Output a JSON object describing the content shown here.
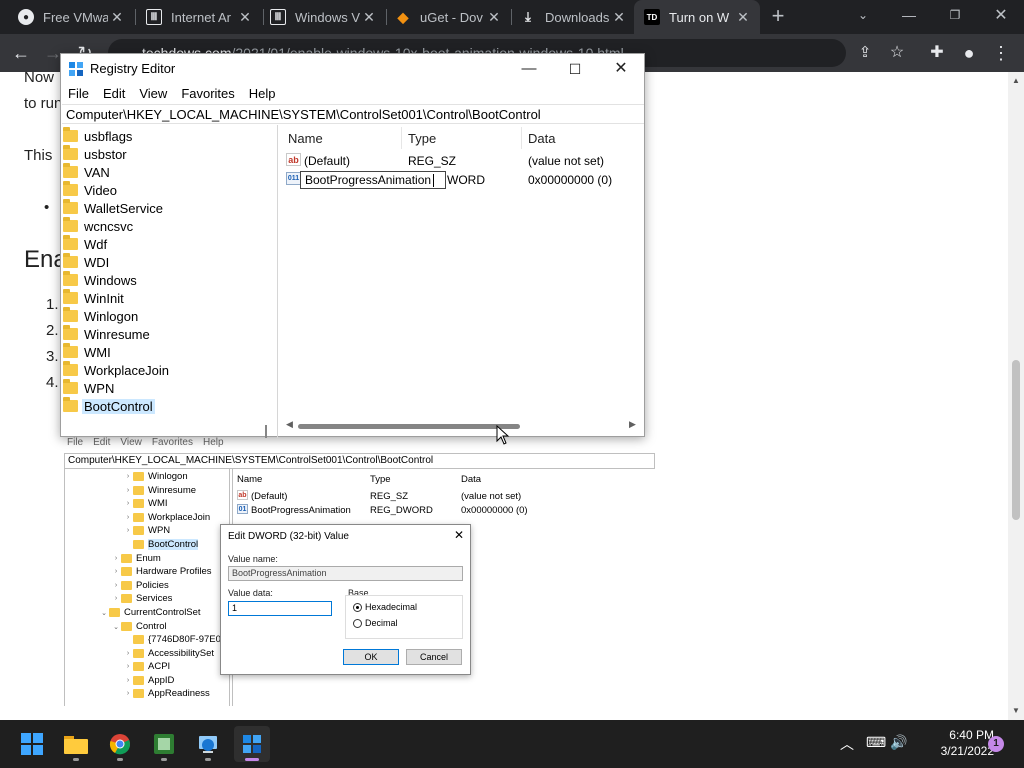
{
  "browser": {
    "tabs": [
      {
        "title": "Free VMwa",
        "icon": "github-icon"
      },
      {
        "title": "Internet Ar",
        "icon": "archive-icon"
      },
      {
        "title": "Windows V",
        "icon": "archive-icon"
      },
      {
        "title": "uGet - Dov",
        "icon": "uget-icon"
      },
      {
        "title": "Downloads",
        "icon": "download-icon"
      },
      {
        "title": "Turn on W",
        "icon": "td-icon",
        "active": true
      }
    ],
    "tab_close": "✕",
    "new_tab": "+",
    "url_host": "techdows.com",
    "url_path": "/2021/01/enable-windows-10x-boot-animation-windows-10.html"
  },
  "page": {
    "line1": "Now",
    "line2": "to run",
    "line3": "This",
    "bullet": "•",
    "heading": "Ena",
    "list": [
      "1.",
      "2.",
      "3.",
      "4."
    ]
  },
  "regedit": {
    "title": "Registry Editor",
    "menu": [
      "File",
      "Edit",
      "View",
      "Favorites",
      "Help"
    ],
    "address": "Computer\\HKEY_LOCAL_MACHINE\\SYSTEM\\ControlSet001\\Control\\BootControl",
    "tree": [
      "usbflags",
      "usbstor",
      "VAN",
      "Video",
      "WalletService",
      "wcncsvc",
      "Wdf",
      "WDI",
      "Windows",
      "WinInit",
      "Winlogon",
      "Winresume",
      "WMI",
      "WorkplaceJoin",
      "WPN",
      "BootControl"
    ],
    "selected": "BootControl",
    "columns": {
      "name": "Name",
      "type": "Type",
      "data": "Data"
    },
    "rows": [
      {
        "name": "(Default)",
        "type": "REG_SZ",
        "data": "(value not set)"
      },
      {
        "name": "BootProgressAnimation",
        "type": "WORD",
        "data": "0x00000000 (0)"
      }
    ],
    "rename_value": "BootProgressAnimation"
  },
  "tutorial": {
    "menu": [
      "File",
      "Edit",
      "View",
      "Favorites",
      "Help"
    ],
    "address": "Computer\\HKEY_LOCAL_MACHINE\\SYSTEM\\ControlSet001\\Control\\BootControl",
    "tree": [
      "Winlogon",
      "Winresume",
      "WMI",
      "WorkplaceJoin",
      "WPN",
      "BootControl",
      "Enum",
      "Hardware Profiles",
      "Policies",
      "Services",
      "CurrentControlSet",
      "Control",
      "{7746D80F-97E0",
      "AccessibilitySet",
      "ACPI",
      "AppID",
      "AppReadiness"
    ],
    "columns": {
      "name": "Name",
      "type": "Type",
      "data": "Data"
    },
    "rows": [
      {
        "name": "(Default)",
        "type": "REG_SZ",
        "data": "(value not set)"
      },
      {
        "name": "BootProgressAnimation",
        "type": "REG_DWORD",
        "data": "0x00000000 (0)"
      }
    ],
    "dialog": {
      "title": "Edit DWORD (32-bit) Value",
      "value_name_label": "Value name:",
      "value_name": "BootProgressAnimation",
      "value_data_label": "Value data:",
      "value_data": "1",
      "base_label": "Base",
      "hex_label": "Hexadecimal",
      "dec_label": "Decimal",
      "ok": "OK",
      "cancel": "Cancel",
      "close": "✕"
    }
  },
  "taskbar": {
    "time": "6:40 PM",
    "date": "3/21/2022",
    "notifications": "1"
  }
}
